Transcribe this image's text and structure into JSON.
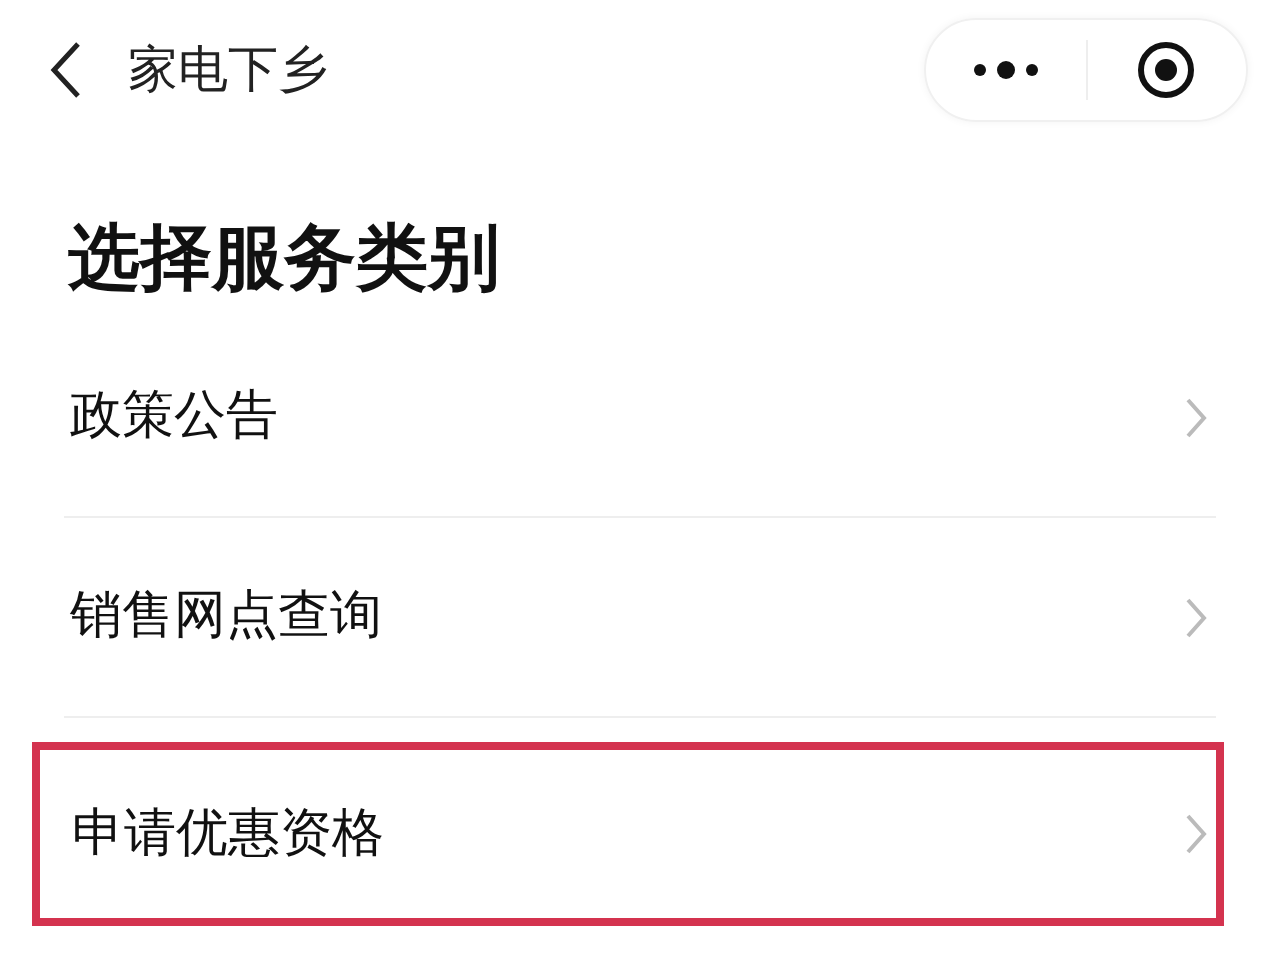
{
  "nav_bar": {
    "title": "家电下乡"
  },
  "heading": "选择服务类别",
  "items": [
    {
      "label": "政策公告",
      "highlighted": false
    },
    {
      "label": "销售网点查询",
      "highlighted": false
    },
    {
      "label": "申请优惠资格",
      "highlighted": true
    }
  ]
}
